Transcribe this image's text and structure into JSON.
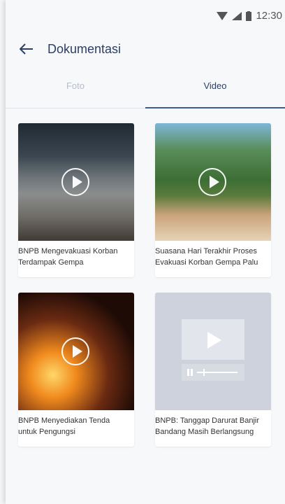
{
  "status_bar": {
    "time": "12:30"
  },
  "header": {
    "title": "Dokumentasi"
  },
  "tabs": [
    {
      "label": "Foto",
      "active": false
    },
    {
      "label": "Video",
      "active": true
    }
  ],
  "videos": [
    {
      "caption": "BNPB Mengevakuasi Korban Terdampak Gempa",
      "thumbnail": "street-scene"
    },
    {
      "caption": "Suasana Hari Terakhir Proses Evakuasi Korban Gempa Palu",
      "thumbnail": "beach-palms"
    },
    {
      "caption": "BNPB Menyediakan Tenda untuk Pengungsi",
      "thumbnail": "fire-scene"
    },
    {
      "caption": "BNPB: Tanggap Darurat Banjir Bandang Masih Berlangsung",
      "thumbnail": "video-placeholder"
    }
  ],
  "colors": {
    "title": "#2c3e64",
    "active_tab_indicator": "#3c5a96",
    "inactive_tab": "#b7bcc6"
  }
}
